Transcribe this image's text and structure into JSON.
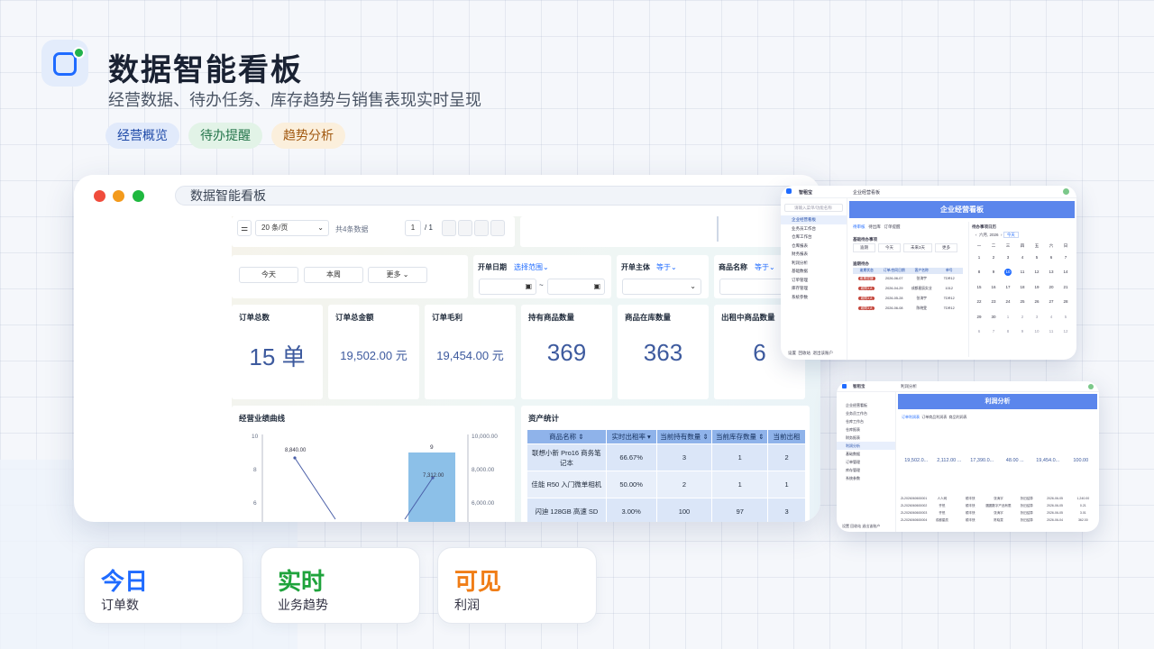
{
  "header": {
    "title": "数据智能看板",
    "subtitle": "经营数据、待办任务、库存趋势与销售表现实时呈现",
    "tags": [
      "经营概览",
      "待办提醒",
      "趋势分析"
    ]
  },
  "window": {
    "title": "数据智能看板",
    "pagination": {
      "page_size": "20 条/页",
      "total": "共4条数据",
      "page": "1",
      "pages": "/ 1"
    },
    "quick_filters": [
      "今天",
      "本周",
      "更多"
    ],
    "filters": [
      {
        "label": "开单日期",
        "op": "选择范围"
      },
      {
        "label": "开单主体",
        "op": "等于"
      },
      {
        "label": "商品名称",
        "op": "等于"
      }
    ],
    "kpis": [
      {
        "label": "订单总数",
        "value": "15 单"
      },
      {
        "label": "订单总金额",
        "value": "19,502.00 元"
      },
      {
        "label": "订单毛利",
        "value": "19,454.00 元"
      },
      {
        "label": "持有商品数量",
        "value": "369"
      },
      {
        "label": "商品在库数量",
        "value": "363"
      },
      {
        "label": "出租中商品数量",
        "value": "6"
      }
    ],
    "perf_chart": {
      "title": "经营业绩曲线",
      "y_left": [
        "10",
        "8",
        "6"
      ],
      "y_right": [
        "10,000.00",
        "8,000.00",
        "6,000.00"
      ],
      "point_labels": [
        "8,840.00",
        "9",
        "7,312.00"
      ]
    },
    "asset": {
      "title": "资产统计",
      "columns": [
        "商品名称",
        "实时出租率",
        "当前持有数量",
        "当前库存数量",
        "当前出租"
      ],
      "rows": [
        [
          "联想小新 Pro16 商务笔记本",
          "66.67%",
          "3",
          "1",
          "2"
        ],
        [
          "佳能 R50 入门微单相机",
          "50.00%",
          "2",
          "1",
          "1"
        ],
        [
          "闪迪 128GB 高速 SD",
          "3.00%",
          "100",
          "97",
          "3"
        ]
      ]
    }
  },
  "side1": {
    "brand": "智租宝",
    "header": "企业经营看板",
    "banner": "企业经营看板",
    "search": "请输入菜单/功能名称",
    "menu": [
      "企业经营看板",
      "业务员工作台",
      "仓库工作台",
      "仓库报表",
      "财务报表",
      "利润分析",
      "基础数据",
      "订单管理",
      "库存管理",
      "系统参数"
    ],
    "tabs": [
      "待审核",
      "待出库",
      "订单提醒"
    ],
    "section": "基础待办事项",
    "sub_btns": [
      "逾期",
      "今天",
      "未来3天",
      "更多"
    ],
    "todo_title": "逾期待办",
    "todo_cols": [
      "逾期状态",
      "订单/合同日期",
      "客户名称",
      "单号"
    ],
    "todo_rows": [
      [
        "逾期提醒",
        "2026-06-07",
        "张涛宇",
        "TDR12"
      ],
      [
        "逾期3天",
        "2026-04-29",
        "成都星辰实业",
        "1012"
      ],
      [
        "逾期3天",
        "2026-05-28",
        "张涛宇",
        "TDR12"
      ],
      [
        "逾期3天",
        "2026-06-08",
        "陈晓雯",
        "TDR12"
      ]
    ],
    "cal_title": "待办事项日历",
    "cal_month": "六月, 2026",
    "cal_today": "今天",
    "weekdays": [
      "一",
      "二",
      "三",
      "四",
      "五",
      "六",
      "日"
    ],
    "days": [
      "1",
      "2",
      "3",
      "4",
      "5",
      "6",
      "7",
      "8",
      "9",
      "10",
      "11",
      "12",
      "13",
      "14",
      "15",
      "16",
      "17",
      "18",
      "19",
      "20",
      "21",
      "22",
      "23",
      "24",
      "25",
      "26",
      "27",
      "28",
      "29",
      "30",
      "1",
      "2",
      "3",
      "4",
      "5",
      "6",
      "7",
      "8",
      "9",
      "10",
      "11",
      "12"
    ],
    "footer": [
      "设置",
      "回收站",
      "退出该账户"
    ]
  },
  "side2": {
    "brand": "智租宝",
    "header": "利润分析",
    "banner": "利润分析",
    "menu": [
      "企业经营看板",
      "业务员工作台",
      "仓库工作台",
      "仓库报表",
      "财务报表",
      "利润分析",
      "基础数据",
      "订单管理",
      "库存管理",
      "系统参数"
    ],
    "tabs": [
      "订单利润表",
      "订单商品利润表",
      "商品利润表"
    ],
    "kpis": [
      "19,502.0...",
      "2,112.00 ...",
      "17,390.0...",
      "48.00 ...",
      "19,454.0...",
      "100.00"
    ],
    "rows": [
      [
        "ZL2026060600001",
        "人人网",
        "顺丰快",
        "张涛宇",
        "折旧结算",
        "2026-06-05",
        "1,240.00"
      ],
      [
        "ZL2026060600002",
        "齐悦",
        "顺丰快",
        "圆圆数字产品有限",
        "折旧结算",
        "2026-06-05",
        "0.21"
      ],
      [
        "ZL2026060600003",
        "齐悦",
        "顺丰快",
        "张涛宇",
        "折旧结算",
        "2026-06-05",
        "3.01"
      ],
      [
        "ZL2026060600004",
        "成都星辰",
        "顺丰快",
        "陈晓雯",
        "折旧结算",
        "2026-06-04",
        "362.00"
      ]
    ],
    "footer": [
      "设置",
      "回收站",
      "退出该账户"
    ]
  },
  "stats": [
    {
      "big": "今日",
      "small": "订单数",
      "color": "#1f6bff"
    },
    {
      "big": "实时",
      "small": "业务趋势",
      "color": "#1fa33c"
    },
    {
      "big": "可见",
      "small": "利润",
      "color": "#f07d16"
    }
  ]
}
